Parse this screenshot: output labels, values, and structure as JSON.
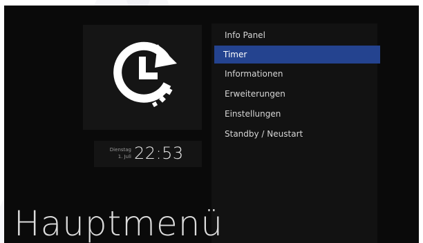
{
  "clock": {
    "weekday": "Dienstag",
    "date": "1. Juli",
    "time": "22:53"
  },
  "menu": {
    "items": [
      {
        "label": "Info Panel"
      },
      {
        "label": "Timer",
        "selected": true
      },
      {
        "label": "Informationen"
      },
      {
        "label": "Erweiterungen"
      },
      {
        "label": "Einstellungen"
      },
      {
        "label": "Standby / Neustart"
      }
    ]
  },
  "title": "Hauptmenü",
  "icons": {
    "selected_item_icon": "timer-icon"
  },
  "colors": {
    "background": "#0a0a0a",
    "panel": "#121212",
    "selection": "#24438f",
    "text": "#d6d6d6"
  }
}
